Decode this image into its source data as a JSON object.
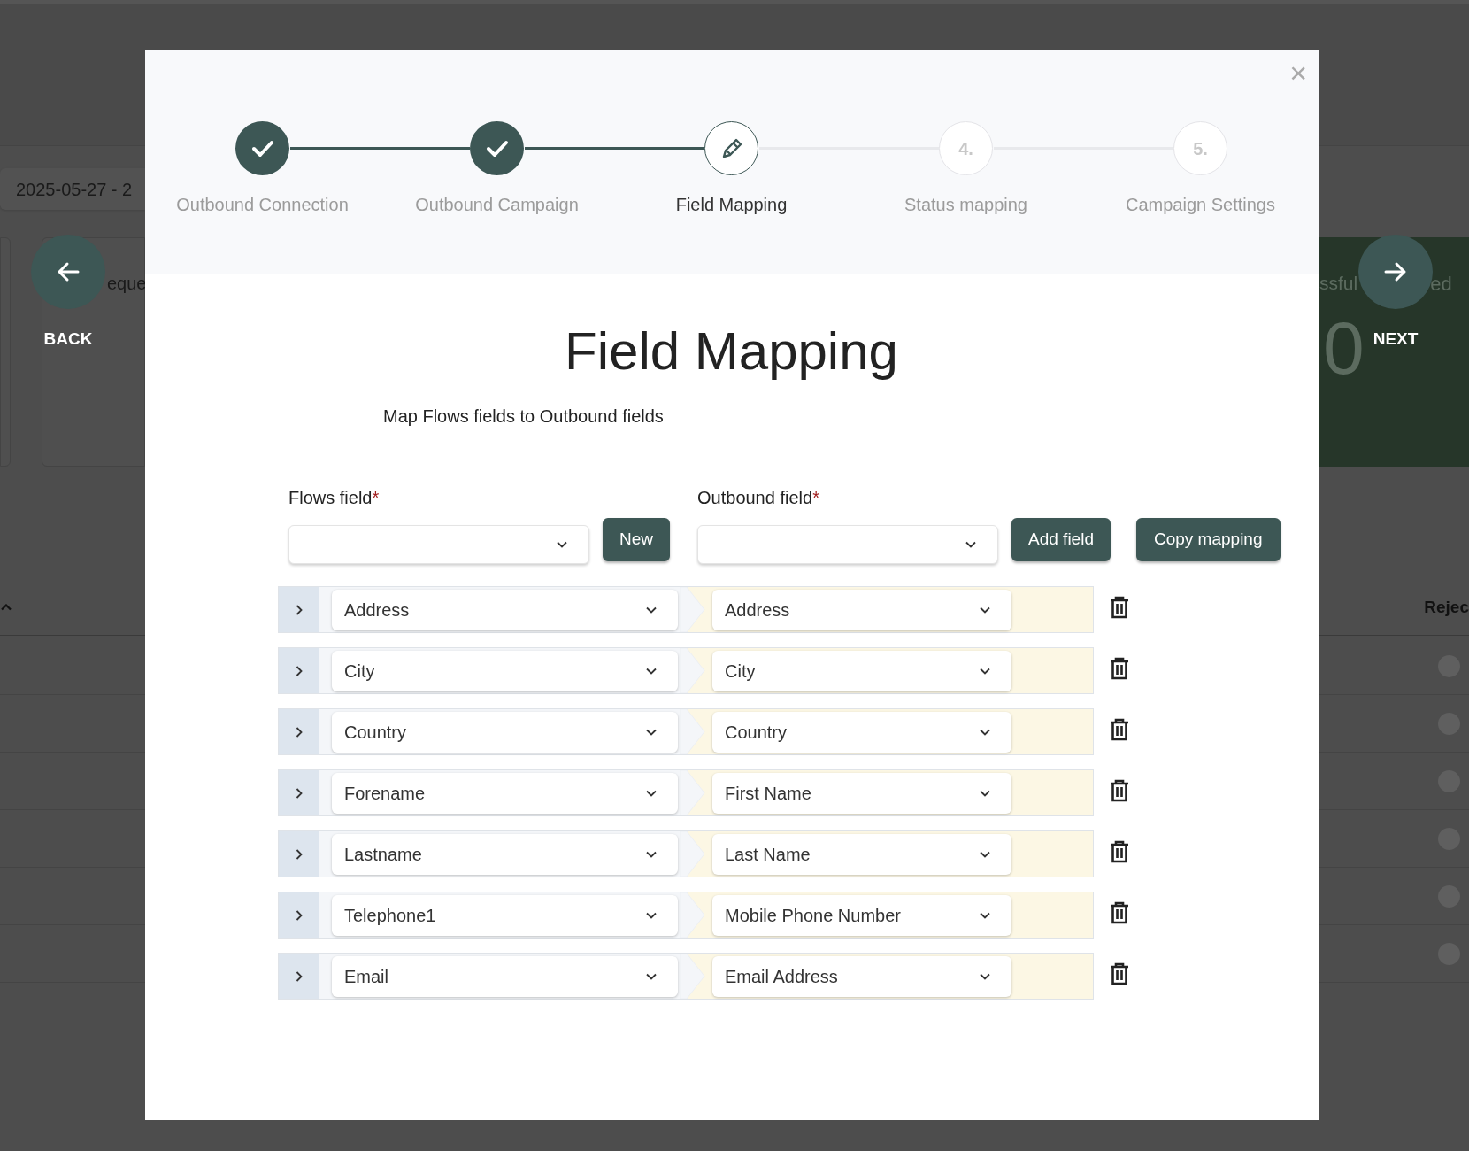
{
  "background": {
    "date_range": "2025-05-27 - 2",
    "card_label": "eque",
    "success_label": "ssful",
    "success_label_end": "ed",
    "success_value": "0",
    "column_header": "Rejec"
  },
  "navigation": {
    "back": "BACK",
    "next": "NEXT"
  },
  "modal": {
    "close": "×",
    "steps": [
      {
        "label": "Outbound Connection",
        "completed": true,
        "selected": false
      },
      {
        "label": "Outbound Campaign",
        "completed": true,
        "selected": false
      },
      {
        "label": "Field Mapping",
        "completed": false,
        "selected": true
      },
      {
        "label": "Status mapping",
        "completed": false,
        "selected": false,
        "marker": "4."
      },
      {
        "label": "Campaign Settings",
        "completed": false,
        "selected": false,
        "marker": "5."
      }
    ],
    "title": "Field Mapping",
    "subtitle": "Map Flows fields to Outbound fields",
    "flows_field": {
      "label": "Flows field",
      "required_mark": "*"
    },
    "outbound_field": {
      "label": "Outbound field",
      "required_mark": "*"
    },
    "buttons": {
      "new": "New",
      "add_field": "Add field",
      "copy_mapping": "Copy mapping"
    },
    "mappings": [
      {
        "flows": "Address",
        "outbound": "Address",
        "expanded": false
      },
      {
        "flows": "City",
        "outbound": "City",
        "expanded": false
      },
      {
        "flows": "Country",
        "outbound": "Country",
        "expanded": false
      },
      {
        "flows": "Forename",
        "outbound": "First Name",
        "expanded": false
      },
      {
        "flows": "Lastname",
        "outbound": "Last Name",
        "expanded": false
      },
      {
        "flows": "Telephone1",
        "outbound": "Mobile Phone Number",
        "expanded": false
      },
      {
        "flows": "Email",
        "outbound": "Email Address",
        "expanded": false
      }
    ]
  }
}
